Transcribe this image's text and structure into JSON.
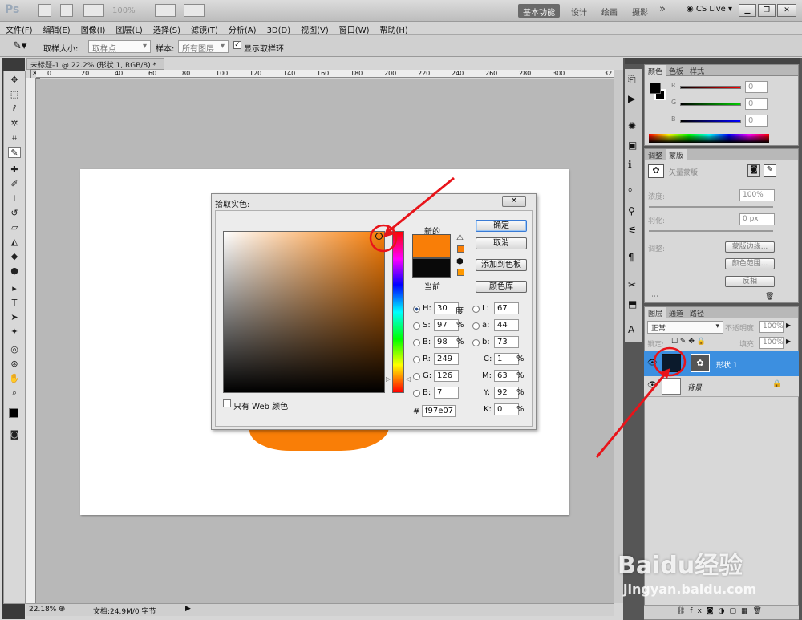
{
  "app": {
    "logo": "Ps",
    "zoom": "100%",
    "workspaces": [
      "基本功能",
      "设计",
      "绘画",
      "摄影"
    ],
    "active_workspace": "基本功能",
    "more": "»",
    "cslive": "CS Live"
  },
  "menu": [
    "文件(F)",
    "编辑(E)",
    "图像(I)",
    "图层(L)",
    "选择(S)",
    "滤镜(T)",
    "分析(A)",
    "3D(D)",
    "视图(V)",
    "窗口(W)",
    "帮助(H)"
  ],
  "options": {
    "sample_size_label": "取样大小:",
    "sample_size_value": "取样点",
    "sample_label": "样本:",
    "sample_value": "所有图层",
    "show_ring_label": "显示取样环"
  },
  "document": {
    "tab_title": "未标题-1 @ 22.2% (形状 1, RGB/8) *",
    "ruler_ticks": [
      "20",
      "0",
      "20",
      "40",
      "60",
      "80",
      "100",
      "120",
      "140",
      "160",
      "180",
      "200",
      "220",
      "240",
      "260",
      "280",
      "300",
      "32"
    ],
    "zoom": "22.18%",
    "docinfo": "文档:24.9M/0 字节"
  },
  "dialog": {
    "title": "拾取实色:",
    "new_label": "新的",
    "current_label": "当前",
    "ok": "确定",
    "cancel": "取消",
    "add_swatch": "添加到色板",
    "libraries": "颜色库",
    "web_only": "只有 Web 颜色",
    "hsb": [
      {
        "k": "H:",
        "v": "30",
        "u": "度"
      },
      {
        "k": "S:",
        "v": "97",
        "u": "%"
      },
      {
        "k": "B:",
        "v": "98",
        "u": "%"
      }
    ],
    "rgb": [
      {
        "k": "R:",
        "v": "249"
      },
      {
        "k": "G:",
        "v": "126"
      },
      {
        "k": "B:",
        "v": "7"
      }
    ],
    "lab": [
      {
        "k": "L:",
        "v": "67"
      },
      {
        "k": "a:",
        "v": "44"
      },
      {
        "k": "b:",
        "v": "73"
      }
    ],
    "cmyk": [
      {
        "k": "C:",
        "v": "1",
        "u": "%"
      },
      {
        "k": "M:",
        "v": "63",
        "u": "%"
      },
      {
        "k": "Y:",
        "v": "92",
        "u": "%"
      },
      {
        "k": "K:",
        "v": "0",
        "u": "%"
      }
    ],
    "hex_label": "#",
    "hex": "f97e07",
    "new_color": "#f97e07",
    "current_color": "#090909"
  },
  "panels": {
    "color_tabs": [
      "颜色",
      "色板",
      "样式"
    ],
    "rgb_values": [
      "0",
      "0",
      "0"
    ],
    "adjust_tabs": [
      "调整",
      "蒙版"
    ],
    "mask_title": "矢量蒙版",
    "density_label": "浓度:",
    "density_value": "100%",
    "feather_label": "羽化:",
    "feather_value": "0 px",
    "refine_label": "调整:",
    "mask_edge": "蒙版边缘...",
    "color_range": "颜色范围...",
    "invert": "反相",
    "layer_tabs": [
      "图层",
      "通道",
      "路径"
    ],
    "blend_mode": "正常",
    "opacity_label": "不透明度:",
    "opacity_value": "100%",
    "lock_label": "锁定:",
    "fill_label": "填充:",
    "fill_value": "100%",
    "layers": [
      {
        "name": "形状 1"
      },
      {
        "name": "背景"
      }
    ]
  },
  "watermark": {
    "brand": "Baidu经验",
    "url": "jingyan.baidu.com"
  }
}
